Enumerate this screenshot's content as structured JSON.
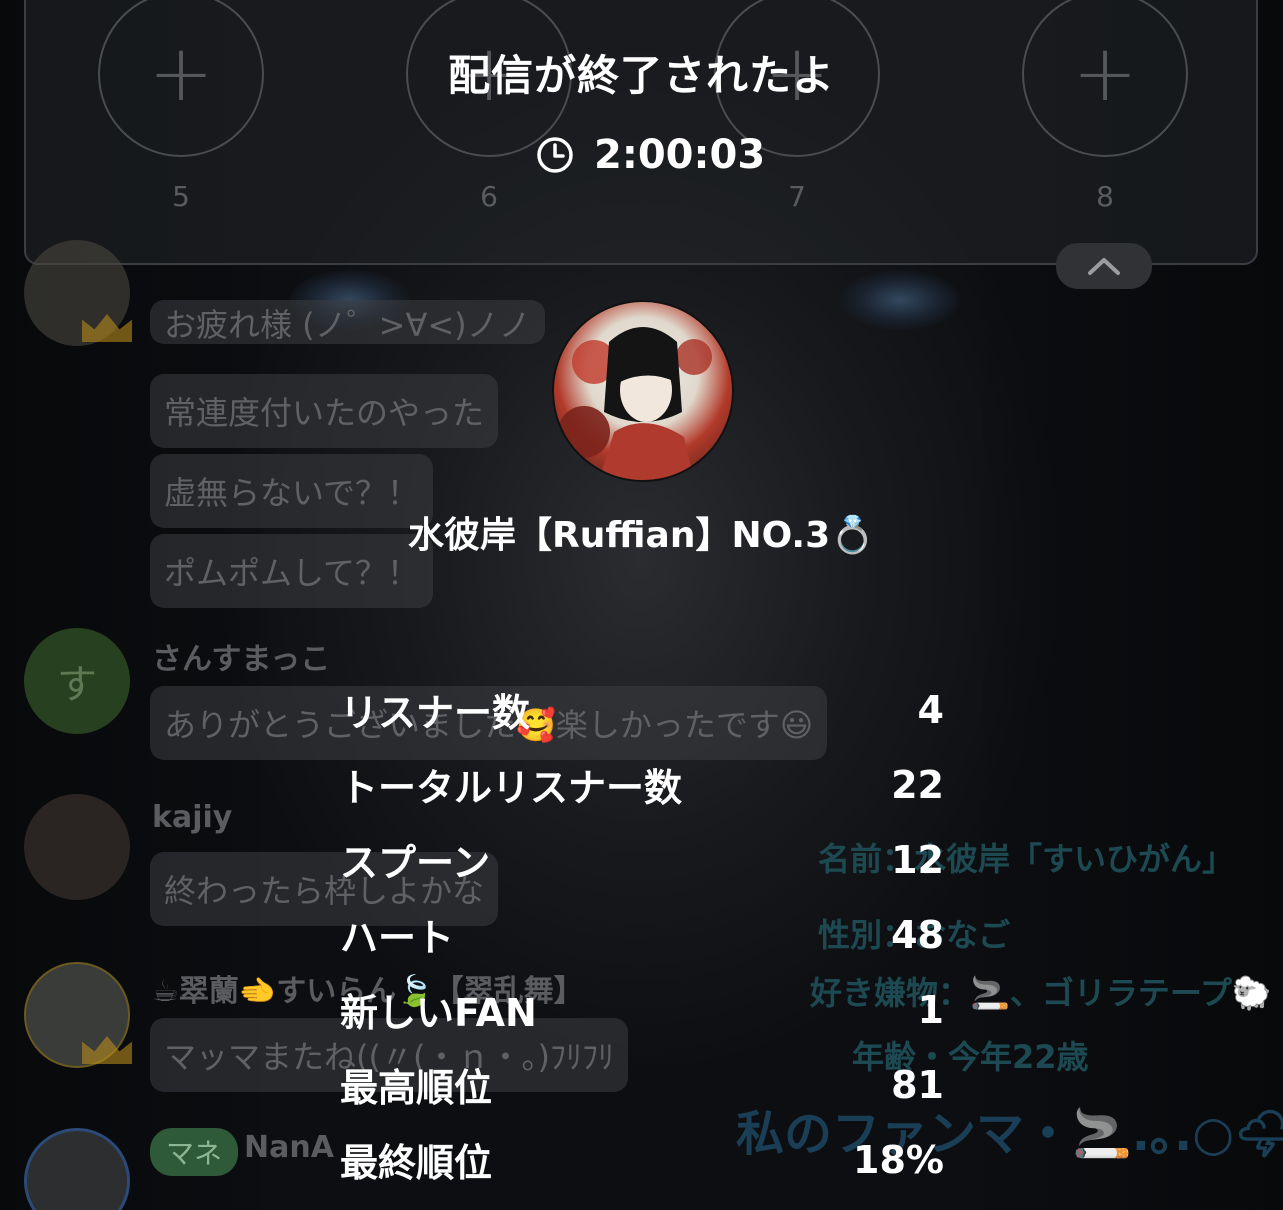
{
  "header": {
    "title": "配信が終了されたよ",
    "duration": "2:00:03"
  },
  "seats": [
    {
      "num": "5"
    },
    {
      "num": "6"
    },
    {
      "num": "7"
    },
    {
      "num": "8"
    }
  ],
  "profile": {
    "name": "水彼岸【Ruffian】NO.3💍"
  },
  "stats": [
    {
      "label": "リスナー数",
      "value": "4"
    },
    {
      "label": "トータルリスナー数",
      "value": "22"
    },
    {
      "label": "スプーン",
      "value": "12"
    },
    {
      "label": "ハート",
      "value": "48"
    },
    {
      "label": "新しいFAN",
      "value": "1"
    },
    {
      "label": "最高順位",
      "value": "81"
    },
    {
      "label": "最終順位",
      "value": "18%"
    }
  ],
  "chat": {
    "partial_top": "お疲れ様 (ノ゜>∀<)ノノ",
    "messages1": [
      "常連度付いたのやった",
      "虚無らないで？！",
      "ポムポムして？！"
    ],
    "user2": {
      "avatar_letter": "す",
      "name": "さんすまっこ",
      "message": "ありがとうございました🥰楽しかったです😃"
    },
    "user3": {
      "name": "kajiy",
      "message": "終わったら枠しよかな"
    },
    "user4": {
      "name": "☕翠蘭🫲すいらん🍃【翠乱舞】",
      "message": "マッマまたね((〃(・ｎ・。)ﾌﾘﾌﾘ"
    },
    "user5": {
      "tag": "マネ",
      "name": "NanA"
    }
  },
  "bio": {
    "line1": "名前：水彼岸「すいひがん」",
    "line2": "性別：おなご",
    "line3": "好き嫌物：🚬、ゴリラテープ🐑",
    "line4": "年齢・今年22歳",
    "line5": "私のファンマ・🚬.｡.○🌩,·"
  },
  "colors": {
    "background": "#0b0d10",
    "overlay_text": "#ffffff",
    "dim_text": "#5d5f63"
  }
}
